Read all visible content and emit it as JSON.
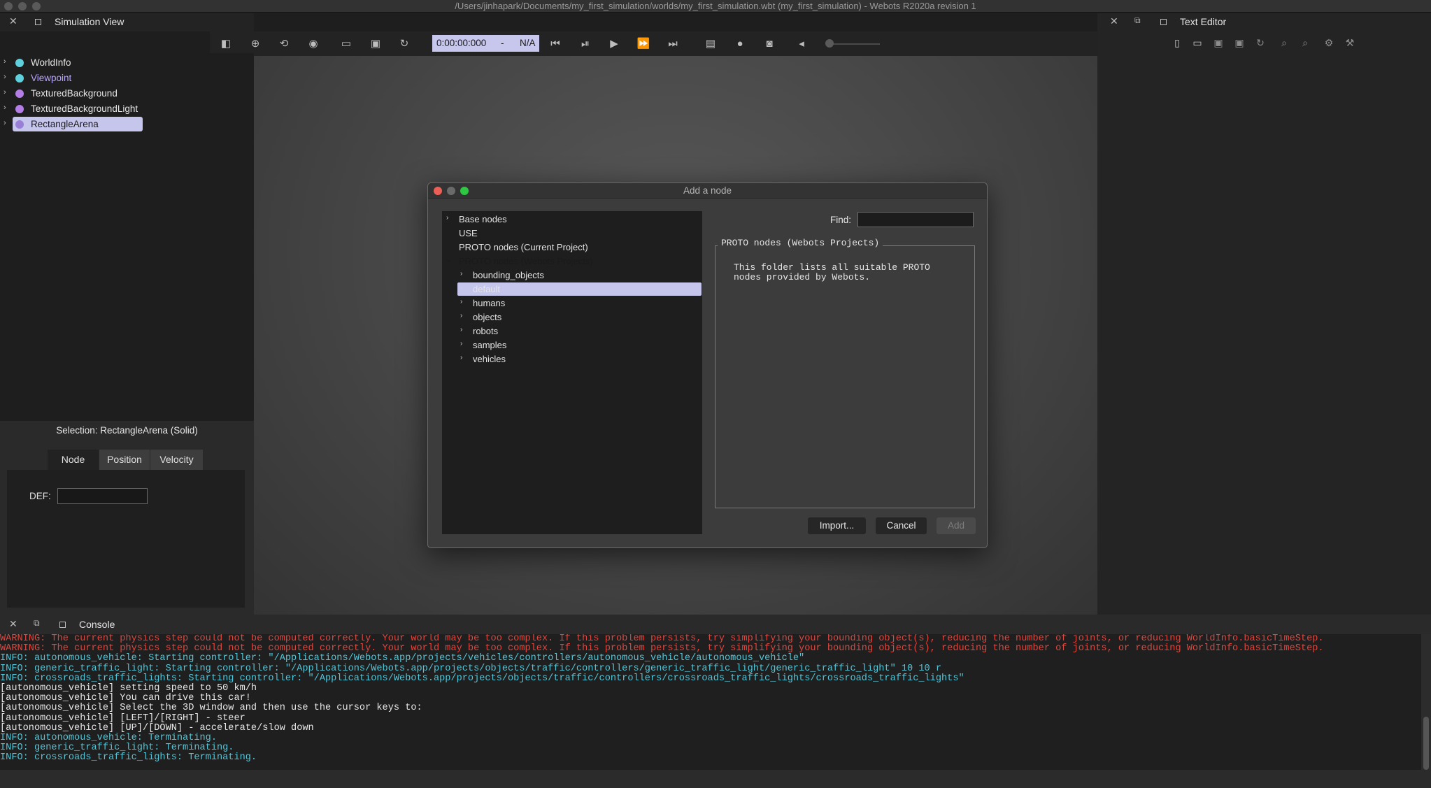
{
  "window": {
    "title": "/Users/jinhapark/Documents/my_first_simulation/worlds/my_first_simulation.wbt (my_first_simulation) - Webots R2020a revision 1"
  },
  "sim_view": {
    "title": "Simulation View",
    "scene_tree": [
      {
        "label": "WorldInfo",
        "color": "#5fd0dd",
        "label_color": "#e6e6e6"
      },
      {
        "label": "Viewpoint",
        "color": "#5fd0dd",
        "label_color": "#b9a5ff"
      },
      {
        "label": "TexturedBackground",
        "color": "#b57ee6",
        "label_color": "#e6e6e6"
      },
      {
        "label": "TexturedBackgroundLight",
        "color": "#b57ee6",
        "label_color": "#e6e6e6"
      },
      {
        "label": "RectangleArena",
        "color": "#9a7fd8",
        "label_color": "#1a1a1a",
        "selected": true
      }
    ],
    "selection_label": "Selection: RectangleArena (Solid)",
    "tabs": [
      "Node",
      "Position",
      "Velocity"
    ],
    "def_label": "DEF:",
    "def_value": ""
  },
  "toolbar": {
    "time": "0:00:00:000",
    "separator": "-",
    "speed": "N/A",
    "icons": [
      "scene-tree-toggle-icon",
      "add-node-icon",
      "reset-view-icon",
      "eye-icon",
      "open-world-icon",
      "save-world-icon",
      "reload-world-icon",
      "reset-simulation-icon",
      "step-icon",
      "play-icon",
      "fast-icon",
      "fastest-icon",
      "video-icon",
      "record-icon",
      "screenshot-icon",
      "mute-icon"
    ]
  },
  "editor": {
    "title": "Text Editor"
  },
  "dialog": {
    "title": "Add a node",
    "tree": {
      "base_nodes": "Base nodes",
      "use": "USE",
      "proto_current": "PROTO nodes (Current Project)",
      "proto_webots": "PROTO nodes (Webots Projects)",
      "children": [
        "bounding_objects",
        "default",
        "humans",
        "objects",
        "robots",
        "samples",
        "vehicles"
      ]
    },
    "find_label": "Find:",
    "find_value": "",
    "description_title": "PROTO nodes (Webots Projects)",
    "description": "This folder lists all suitable PROTO\nnodes provided by Webots.",
    "buttons": {
      "import": "Import...",
      "cancel": "Cancel",
      "add": "Add"
    }
  },
  "console": {
    "title": "Console",
    "lines": [
      {
        "type": "warn",
        "text": "WARNING: The current physics step could not be computed correctly. Your world may be too complex. If this problem persists, try simplifying your bounding object(s), reducing the number of joints, or reducing WorldInfo.basicTimeStep."
      },
      {
        "type": "warn",
        "text": "WARNING: The current physics step could not be computed correctly. Your world may be too complex. If this problem persists, try simplifying your bounding object(s), reducing the number of joints, or reducing WorldInfo.basicTimeStep."
      },
      {
        "type": "info",
        "text": "INFO: autonomous_vehicle: Starting controller: \"/Applications/Webots.app/projects/vehicles/controllers/autonomous_vehicle/autonomous_vehicle\""
      },
      {
        "type": "info",
        "text": "INFO: generic_traffic_light: Starting controller: \"/Applications/Webots.app/projects/objects/traffic/controllers/generic_traffic_light/generic_traffic_light\" 10 10 r"
      },
      {
        "type": "info",
        "text": "INFO: crossroads_traffic_lights: Starting controller: \"/Applications/Webots.app/projects/objects/traffic/controllers/crossroads_traffic_lights/crossroads_traffic_lights\""
      },
      {
        "type": "plain",
        "text": "[autonomous_vehicle] setting speed to 50 km/h"
      },
      {
        "type": "plain",
        "text": "[autonomous_vehicle] You can drive this car!"
      },
      {
        "type": "plain",
        "text": "[autonomous_vehicle] Select the 3D window and then use the cursor keys to:"
      },
      {
        "type": "plain",
        "text": "[autonomous_vehicle] [LEFT]/[RIGHT] - steer"
      },
      {
        "type": "plain",
        "text": "[autonomous_vehicle] [UP]/[DOWN] - accelerate/slow down"
      },
      {
        "type": "info",
        "text": "INFO: autonomous_vehicle: Terminating."
      },
      {
        "type": "info",
        "text": "INFO: generic_traffic_light: Terminating."
      },
      {
        "type": "info",
        "text": "INFO: crossroads_traffic_lights: Terminating."
      }
    ]
  }
}
